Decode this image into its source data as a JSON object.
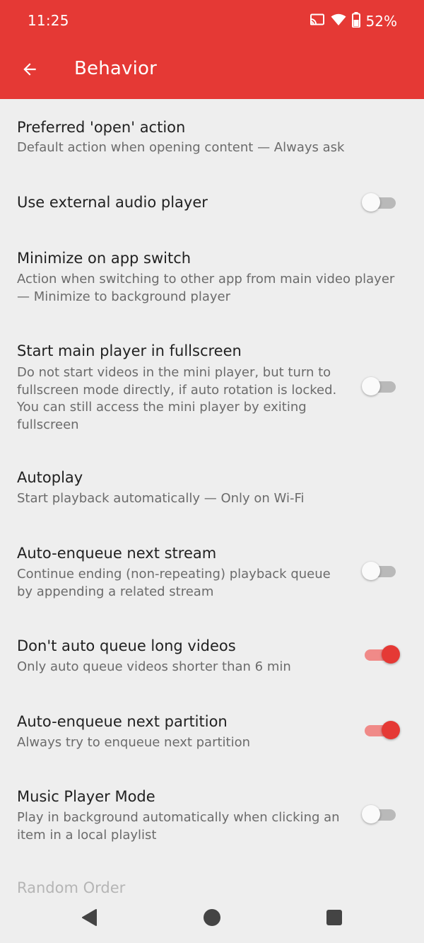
{
  "status_bar": {
    "time": "11:25",
    "battery_pct": "52%",
    "icons": [
      "cast-icon",
      "wifi-icon",
      "battery-icon"
    ]
  },
  "toolbar": {
    "title": "Behavior",
    "back_icon": "arrow-left-icon"
  },
  "colors": {
    "accent": "#e53935",
    "background": "#eeeeee",
    "title_text": "#212121",
    "summary_text": "#6b6b6b"
  },
  "preferences": [
    {
      "title": "Preferred 'open' action",
      "summary": "Default action when opening content — Always ask"
    },
    {
      "title": "Use external audio player",
      "switch_on": false
    },
    {
      "title": "Minimize on app switch",
      "summary": "Action when switching to other app from main video player — Minimize to background player"
    },
    {
      "title": "Start main player in fullscreen",
      "summary": "Do not start videos in the mini player, but turn to fullscreen mode directly, if auto rotation is locked. You can still access the mini player by exiting fullscreen",
      "switch_on": false
    },
    {
      "title": "Autoplay",
      "summary": "Start playback automatically — Only on Wi-Fi"
    },
    {
      "title": "Auto-enqueue next stream",
      "summary": "Continue ending (non-repeating) playback queue by appending a related stream",
      "switch_on": false
    },
    {
      "title": "Don't auto queue long videos",
      "summary": "Only auto queue videos shorter than 6 min",
      "switch_on": true
    },
    {
      "title": "Auto-enqueue next partition",
      "summary": "Always try to enqueue next partition",
      "switch_on": true
    },
    {
      "title": "Music Player Mode",
      "summary": "Play in background automatically when clicking an item in a local playlist",
      "switch_on": false
    },
    {
      "title": "Random Order"
    }
  ],
  "nav_bar": {
    "icons": [
      "back-triangle-icon",
      "home-circle-icon",
      "recents-square-icon"
    ]
  }
}
